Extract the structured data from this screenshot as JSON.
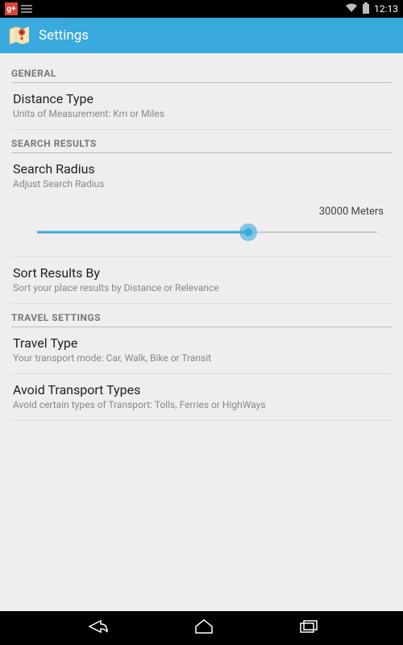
{
  "status": {
    "time": "12:13"
  },
  "header": {
    "title": "Settings"
  },
  "sections": {
    "general": {
      "label": "GENERAL",
      "distance_type": {
        "title": "Distance Type",
        "summary": "Units of Measurement: Km or Miles"
      }
    },
    "search_results": {
      "label": "SEARCH RESULTS",
      "search_radius": {
        "title": "Search Radius",
        "summary": "Adjust Search Radius",
        "value_label": "30000 Meters",
        "value": 30000,
        "max": 50000,
        "fill_percent": 62
      },
      "sort_by": {
        "title": "Sort Results By",
        "summary": "Sort your place results by Distance or Relevance"
      }
    },
    "travel": {
      "label": "TRAVEL SETTINGS",
      "travel_type": {
        "title": "Travel Type",
        "summary": "Your transport mode: Car, Walk, Bike or Transit"
      },
      "avoid": {
        "title": "Avoid Transport Types",
        "summary": "Avoid certain types of Transport: Tolls, Ferries or HighWays"
      }
    }
  }
}
